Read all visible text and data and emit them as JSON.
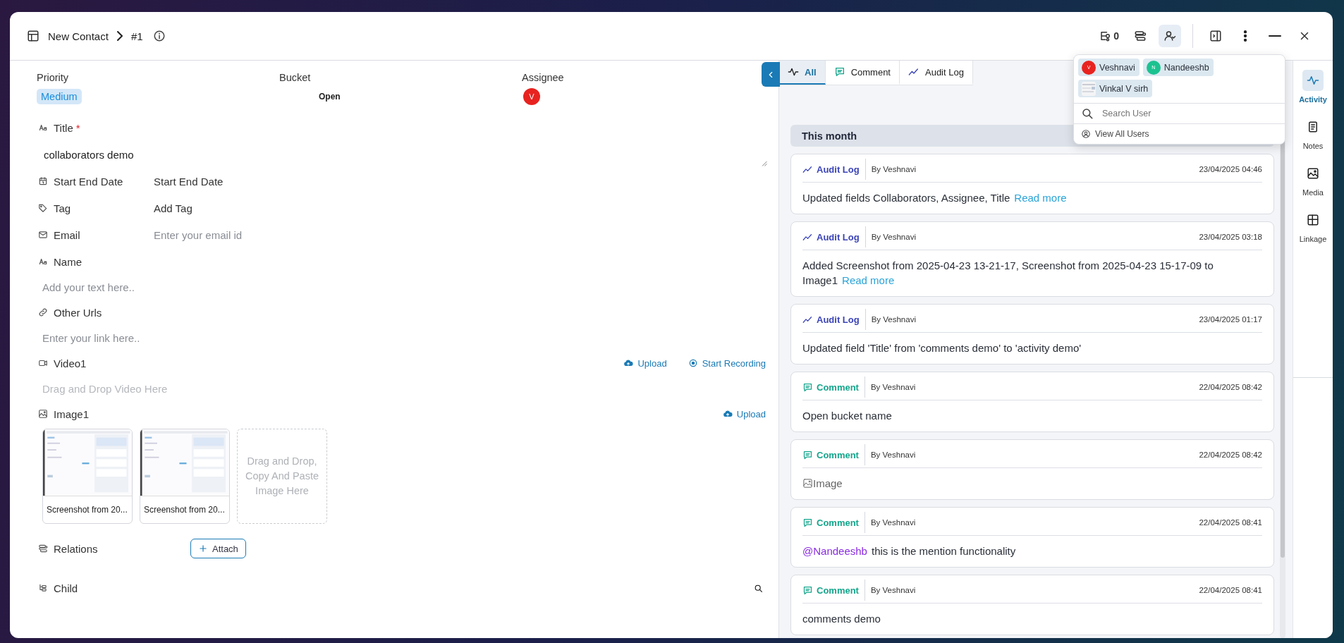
{
  "header": {
    "title": "New Contact",
    "record_id": "#1",
    "tools": [
      {
        "kind": "collaborators",
        "count": "0",
        "selected": false
      },
      {
        "kind": "relations",
        "selected": false
      },
      {
        "kind": "users",
        "selected": true
      },
      {
        "kind": "panel",
        "selected": false
      },
      {
        "kind": "more",
        "selected": false
      },
      {
        "kind": "minimize",
        "selected": false
      },
      {
        "kind": "close",
        "selected": false
      }
    ]
  },
  "form": {
    "summary": [
      {
        "kind": "badge",
        "label": "Priority",
        "value": "Medium"
      },
      {
        "kind": "text",
        "label": "Bucket",
        "value": "Open"
      },
      {
        "kind": "avatar",
        "label": "Assignee",
        "value": "V"
      }
    ],
    "fields": [
      {
        "kind": "textarea",
        "label": "Title",
        "required_mark": "*",
        "value": "collaborators demo"
      },
      {
        "kind": "inline",
        "label": "Start End Date",
        "value": "Start End Date"
      },
      {
        "kind": "inline",
        "label": "Tag",
        "value": "Add Tag"
      },
      {
        "kind": "inline",
        "label": "Email",
        "placeholder": "Enter your email id"
      },
      {
        "kind": "stacked",
        "label": "Name",
        "placeholder": "Add your text here.."
      },
      {
        "kind": "stacked",
        "label": "Other Urls",
        "placeholder": "Enter your link here.."
      },
      {
        "kind": "media",
        "label": "Video1",
        "actions": [
          {
            "kind": "upload",
            "label": "Upload"
          },
          {
            "kind": "record",
            "label": "Start Recording"
          }
        ],
        "drop": "Drag and Drop Video Here"
      },
      {
        "kind": "images",
        "label": "Image1",
        "actions": [
          {
            "kind": "upload",
            "label": "Upload"
          }
        ],
        "thumbnails": [
          {
            "caption": "Screenshot from 20..."
          },
          {
            "caption": "Screenshot from 20..."
          }
        ],
        "drop": "Drag and Drop, Copy And Paste Image Here"
      },
      {
        "kind": "attach",
        "label": "Relations",
        "button": "Attach"
      },
      {
        "kind": "search",
        "label": "Child"
      }
    ]
  },
  "activity": {
    "tabs": [
      {
        "kind": "all",
        "label": "All",
        "selected": true
      },
      {
        "kind": "comment",
        "label": "Comment",
        "selected": false
      },
      {
        "kind": "audit",
        "label": "Audit Log",
        "selected": false
      }
    ],
    "group": "This month",
    "entries": [
      {
        "kind": "audit",
        "type_label": "Audit Log",
        "author": "By Veshnavi",
        "time": "23/04/2025 04:46",
        "text": "Updated fields Collaborators, Assignee, Title",
        "link": "Read more"
      },
      {
        "kind": "audit",
        "type_label": "Audit Log",
        "author": "By Veshnavi",
        "time": "23/04/2025 03:18",
        "text": "Added Screenshot from 2025-04-23 13-21-17, Screenshot from 2025-04-23 15-17-09 to Image1",
        "link": "Read more"
      },
      {
        "kind": "audit",
        "type_label": "Audit Log",
        "author": "By Veshnavi",
        "time": "23/04/2025 01:17",
        "text": "Updated field 'Title' from 'comments demo' to 'activity demo'"
      },
      {
        "kind": "comment",
        "type_label": "Comment",
        "author": "By Veshnavi",
        "time": "22/04/2025 08:42",
        "text": "Open bucket name"
      },
      {
        "kind": "comment",
        "type_label": "Comment",
        "author": "By Veshnavi",
        "time": "22/04/2025 08:42",
        "image_alt": "Image"
      },
      {
        "kind": "comment",
        "type_label": "Comment",
        "author": "By Veshnavi",
        "time": "22/04/2025 08:41",
        "mention": "@Nandeeshb",
        "text": "this is the mention functionality"
      },
      {
        "kind": "comment",
        "type_label": "Comment",
        "author": "By Veshnavi",
        "time": "22/04/2025 08:41",
        "text": "comments demo"
      }
    ]
  },
  "rail": [
    {
      "kind": "activity",
      "label": "Activity",
      "selected": true
    },
    {
      "kind": "notes",
      "label": "Notes",
      "selected": false
    },
    {
      "kind": "media",
      "label": "Media",
      "selected": false
    },
    {
      "kind": "linkage",
      "label": "Linkage",
      "selected": false
    }
  ],
  "collaborators_popover": {
    "users": [
      {
        "kind": "initial",
        "name": "Veshnavi",
        "initial": "V",
        "color": "#e8231f"
      },
      {
        "kind": "initial",
        "name": "Nandeeshb",
        "initial": "N",
        "color": "#1cc290"
      },
      {
        "kind": "picture",
        "name": "Vinkal V sirh"
      }
    ],
    "search_placeholder": "Search User",
    "view_all": "View All Users"
  }
}
